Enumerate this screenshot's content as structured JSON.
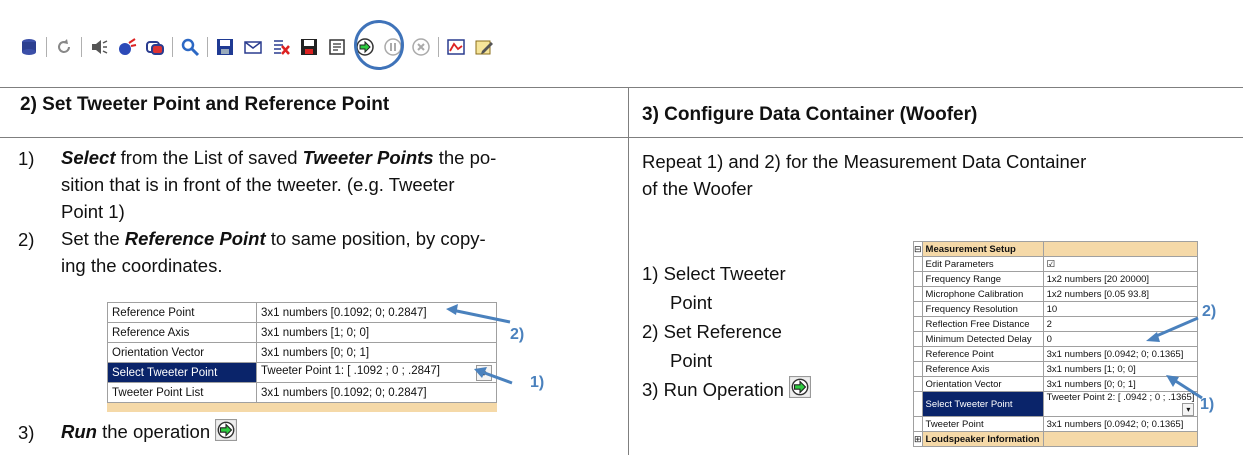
{
  "toolbar": {
    "icons": [
      "database-icon",
      "refresh-icon",
      "speaker-icon",
      "sweep-icon",
      "layers-icon",
      "search-icon",
      "save-icon",
      "mail-icon",
      "clear-icon",
      "save-as-icon",
      "properties-icon",
      "run-icon",
      "pause-icon",
      "stop-icon",
      "chart-icon",
      "edit-icon"
    ]
  },
  "left": {
    "heading": "2) Set Tweeter Point and Reference Point",
    "step1_num": "1)",
    "step1_a": "Select",
    "step1_b": " from the List of saved ",
    "step1_c": "Tweeter Points",
    "step1_d": " the po-",
    "step1_line2": "sition that is in front of the tweeter. (e.g. Tweeter",
    "step1_line3": "Point 1)",
    "step2_num": "2)",
    "step2_a": "Set the ",
    "step2_b": "Reference Point",
    "step2_c": " to same position, by copy-",
    "step2_line2": "ing the coordinates.",
    "step3_num": "3)",
    "step3_a": "Run",
    "step3_b": " the operation",
    "grid": [
      {
        "key": "Reference Point",
        "value": "3x1 numbers [0.1092; 0; 0.2847]"
      },
      {
        "key": "Reference Axis",
        "value": "3x1 numbers [1; 0; 0]"
      },
      {
        "key": "Orientation Vector",
        "value": "3x1 numbers [0; 0; 1]"
      },
      {
        "key": "Select Tweeter Point",
        "value": "Tweeter Point 1: [ .1092 ; 0 ; .2847]"
      },
      {
        "key": "Tweeter Point List",
        "value": "3x1 numbers [0.1092; 0; 0.2847]"
      }
    ],
    "callout_2": "2)",
    "callout_1": "1)"
  },
  "right": {
    "heading": "3) Configure Data Container (Woofer)",
    "intro_line1": "Repeat 1) and 2) for the Measurement Data Container",
    "intro_line2": "of the Woofer",
    "list1": "1) Select Tweeter",
    "list1b": "Point",
    "list2": "2) Set Reference",
    "list2b": "Point",
    "list3": "3) Run Operation",
    "grid_section1": "Measurement Setup",
    "grid": [
      {
        "key": "Edit Parameters",
        "value": "☑"
      },
      {
        "key": "Frequency Range",
        "value": "1x2 numbers [20 20000]"
      },
      {
        "key": "Microphone Calibration",
        "value": "1x2 numbers [0.05 93.8]"
      },
      {
        "key": "Frequency Resolution",
        "value": "10"
      },
      {
        "key": "Reflection Free Distance",
        "value": "2"
      },
      {
        "key": "Minimum Detected Delay",
        "value": "0"
      },
      {
        "key": "Reference Point",
        "value": "3x1 numbers [0.0942; 0; 0.1365]"
      },
      {
        "key": "Reference Axis",
        "value": "3x1 numbers [1; 0; 0]"
      },
      {
        "key": "Orientation Vector",
        "value": "3x1 numbers [0; 0; 1]"
      },
      {
        "key": "Select Tweeter Point",
        "value": "Tweeter Point 2: [ .0942 ; 0 ; .1365]"
      },
      {
        "key": "Tweeter Point",
        "value": "3x1 numbers [0.0942; 0; 0.1365]"
      }
    ],
    "grid_section2": "Loudspeaker Information",
    "callout_2": "2)",
    "callout_1": "1)"
  },
  "colors": {
    "callout": "#4a81bd",
    "selected_row": "#0a246a",
    "section": "#f5d9a8"
  }
}
